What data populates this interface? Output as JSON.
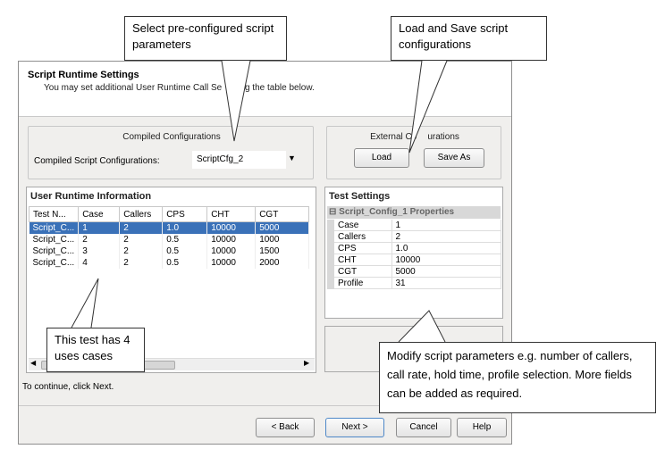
{
  "callouts": {
    "select": "Select pre-configured script parameters",
    "load": "Load and Save script configurations",
    "test": "This test has 4 uses cases",
    "modify": "Modify script parameters e.g. number of callers, call rate, hold time, profile selection. More fields can be added as required."
  },
  "dialog": {
    "title": "Script Runtime Settings",
    "subtitle": "You may set additional User Runtime Call Se",
    "subtitle_tail": "ing the table below.",
    "compiled": {
      "group_label": "Compiled Configurations",
      "field_label": "Compiled Script Configurations:",
      "selected": "ScriptCfg_2"
    },
    "external": {
      "group_label_left": "External Co",
      "group_label_right": "urations",
      "load_label": "Load",
      "saveas_label": "Save As"
    },
    "runtime": {
      "title": "User Runtime Information",
      "columns": [
        "Test N...",
        "Case",
        "Callers",
        "CPS",
        "CHT",
        "CGT"
      ],
      "rows": [
        [
          "Script_C...",
          "1",
          "2",
          "1.0",
          "10000",
          "5000"
        ],
        [
          "Script_C...",
          "2",
          "2",
          "0.5",
          "10000",
          "1000"
        ],
        [
          "Script_C...",
          "3",
          "2",
          "0.5",
          "10000",
          "1500"
        ],
        [
          "Script_C...",
          "4",
          "2",
          "0.5",
          "10000",
          "2000"
        ]
      ]
    },
    "test_settings": {
      "title": "Test Settings",
      "header": "Script_Config_1 Properties",
      "rows": [
        [
          "Case",
          "1"
        ],
        [
          "Callers",
          "2"
        ],
        [
          "CPS",
          "1.0"
        ],
        [
          "CHT",
          "10000"
        ],
        [
          "CGT",
          "5000"
        ],
        [
          "Profile",
          "31"
        ]
      ]
    },
    "continue_text": "To continue, click Next.",
    "buttons": {
      "back": "< Back",
      "next": "Next >",
      "cancel": "Cancel",
      "help": "Help"
    }
  }
}
